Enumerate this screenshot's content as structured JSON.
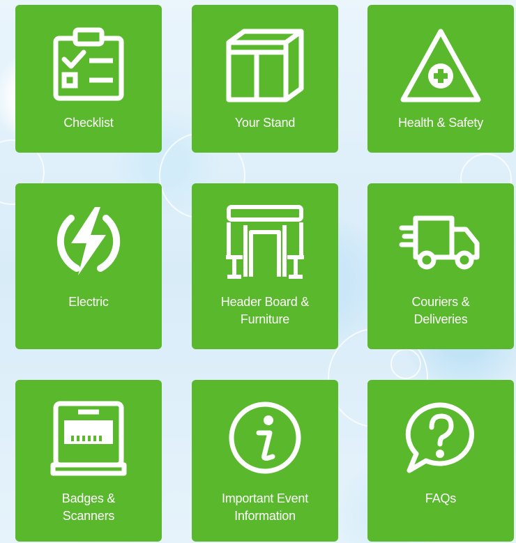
{
  "tiles": [
    {
      "id": "checklist",
      "lines": [
        "Checklist"
      ],
      "icon": "checklist-icon"
    },
    {
      "id": "your-stand",
      "lines": [
        "Your Stand"
      ],
      "icon": "stand-icon"
    },
    {
      "id": "health-safety",
      "lines": [
        "Health & Safety"
      ],
      "icon": "warning-triangle-icon"
    },
    {
      "id": "electric",
      "lines": [
        "Electric"
      ],
      "icon": "lightning-icon"
    },
    {
      "id": "header-board",
      "lines": [
        "Header Board &",
        "Furniture"
      ],
      "icon": "furniture-icon"
    },
    {
      "id": "couriers",
      "lines": [
        "Couriers &",
        "Deliveries"
      ],
      "icon": "delivery-truck-icon"
    },
    {
      "id": "badges",
      "lines": [
        "Badges &",
        "Scanners"
      ],
      "icon": "scanner-icon"
    },
    {
      "id": "event-info",
      "lines": [
        "Important Event",
        "Information"
      ],
      "icon": "info-icon"
    },
    {
      "id": "faqs",
      "lines": [
        "FAQs"
      ],
      "icon": "question-bubble-icon"
    }
  ],
  "colors": {
    "tile": "#5ab82c",
    "icon": "#ffffff"
  }
}
